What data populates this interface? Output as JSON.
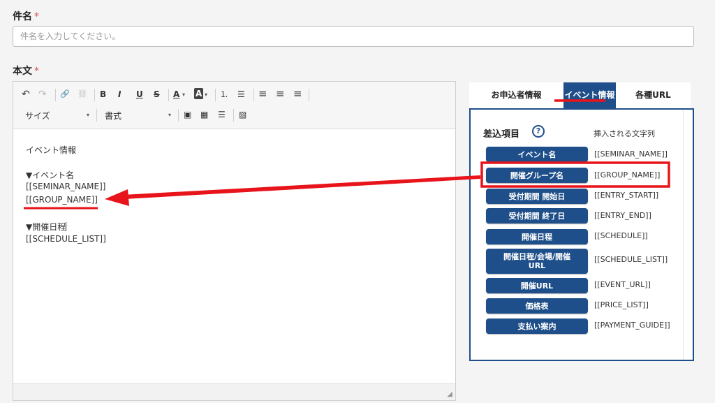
{
  "subject": {
    "label": "件名",
    "required_mark": "*",
    "placeholder": "件名を入力してください。"
  },
  "body": {
    "label": "本文",
    "required_mark": "*"
  },
  "toolbar": {
    "undo": "↶",
    "redo": "↷",
    "link": "🔗",
    "unlink": "⛓",
    "bold": "B",
    "italic": "I",
    "underline": "U",
    "strike": "S",
    "text_color": "A",
    "bg_color": "A",
    "ordered_list": "⒈",
    "bullet_list": "☰",
    "align_left": "≡",
    "align_center": "≡",
    "align_right": "≡",
    "size_label": "サイズ",
    "format_label": "書式",
    "image_url": "▣",
    "table": "▦",
    "hr": "☰",
    "image": "▨"
  },
  "editor_content": {
    "lines": [
      "イベント情報",
      "",
      "▼イベント名",
      "[[SEMINAR_NAME]]",
      "[[GROUP_NAME]]",
      "",
      "▼開催日程",
      "[[SCHEDULE_LIST]]"
    ]
  },
  "tabs": [
    {
      "label": "お申込者情報"
    },
    {
      "label": "イベント情報"
    },
    {
      "label": "各種URL"
    }
  ],
  "panel": {
    "heading": "差込項目",
    "help": "?",
    "column_header": "挿入される文字列",
    "items": [
      {
        "label": "イベント名",
        "value": "[[SEMINAR_NAME]]"
      },
      {
        "label": "開催グループ名",
        "value": "[[GROUP_NAME]]"
      },
      {
        "label": "受付期間 開始日",
        "value": "[[ENTRY_START]]"
      },
      {
        "label": "受付期間 終了日",
        "value": "[[ENTRY_END]]"
      },
      {
        "label": "開催日程",
        "value": "[[SCHEDULE]]"
      },
      {
        "label": "開催日程/会場/開催URL",
        "value": "[[SCHEDULE_LIST]]"
      },
      {
        "label": "開催URL",
        "value": "[[EVENT_URL]]"
      },
      {
        "label": "価格表",
        "value": "[[PRICE_LIST]]"
      },
      {
        "label": "支払い案内",
        "value": "[[PAYMENT_GUIDE]]"
      }
    ]
  },
  "colors": {
    "accent": "#1e4f8a",
    "annotation": "#e8141b",
    "required": "#d9534f"
  }
}
